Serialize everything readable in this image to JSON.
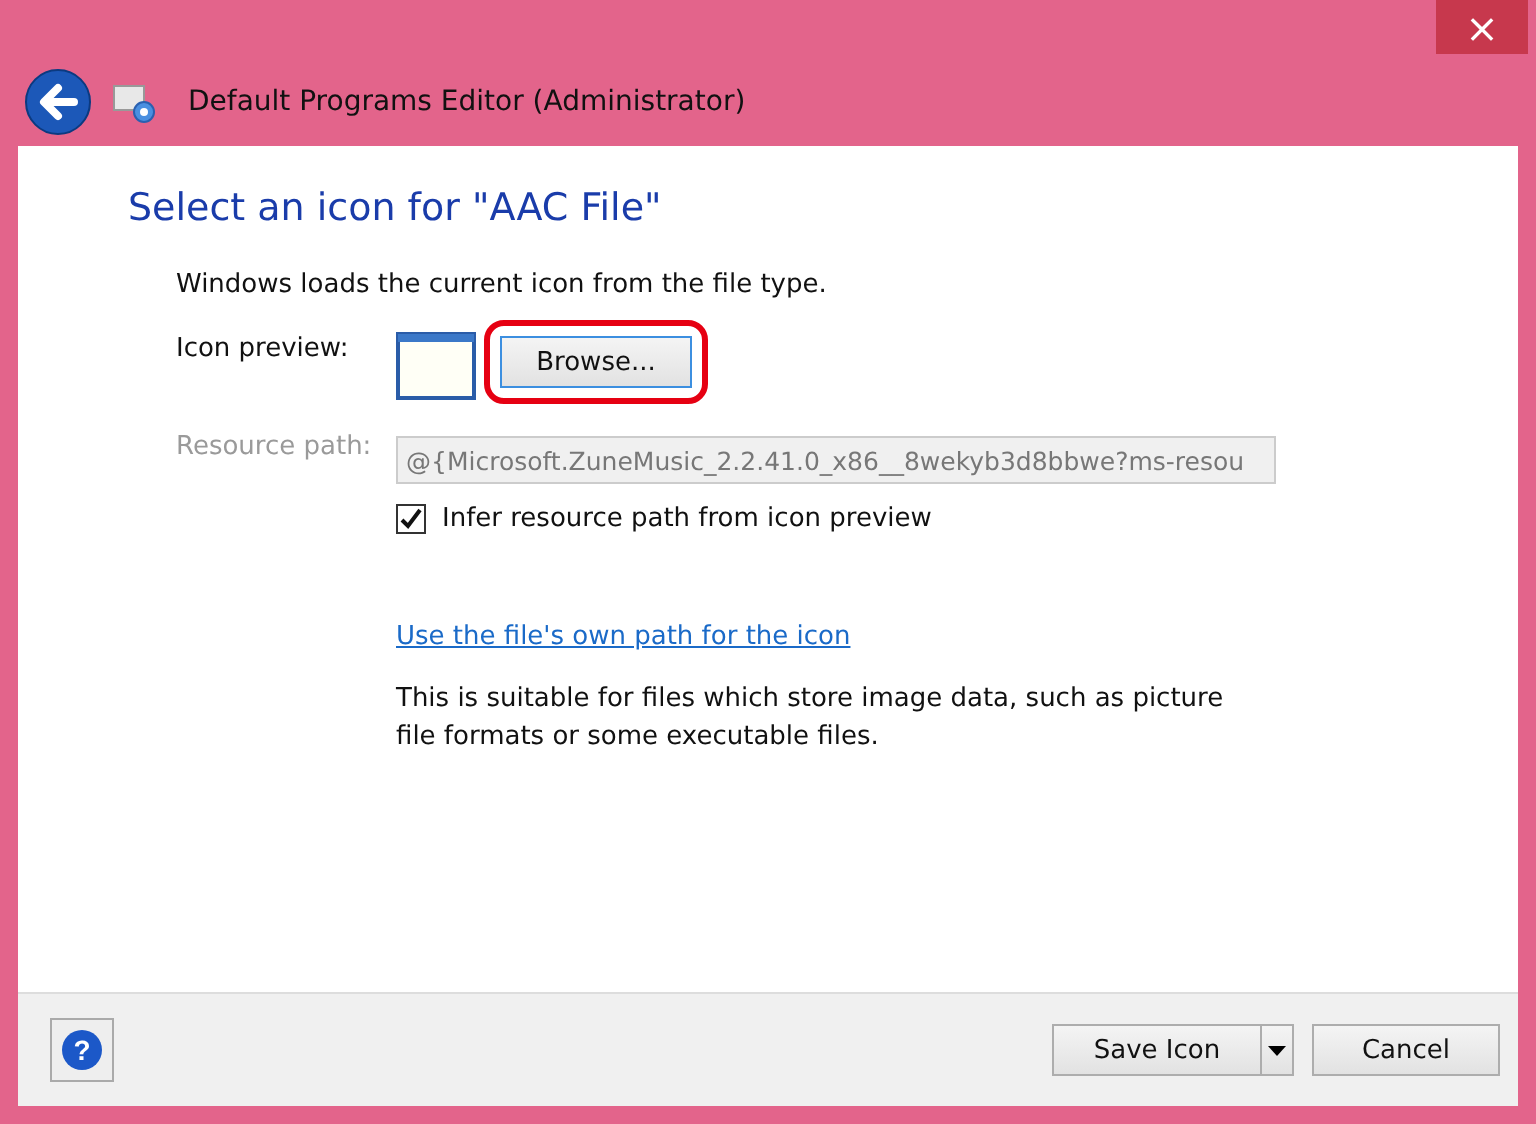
{
  "window": {
    "title": "Default Programs Editor (Administrator)",
    "close": "×"
  },
  "heading": "Select an icon for \"AAC File\"",
  "intro": "Windows loads the current icon from the file type.",
  "icon_preview": {
    "label": "Icon preview:",
    "browse_button": "Browse...",
    "highlighted": true
  },
  "resource_path": {
    "label": "Resource path:",
    "value": "@{Microsoft.ZuneMusic_2.2.41.0_x86__8wekyb3d8bbwe?ms-resou",
    "disabled": true
  },
  "infer_checkbox": {
    "label": "Infer resource path from icon preview",
    "checked": true
  },
  "link": "Use the file's own path for the icon",
  "note": "This is suitable for files which store image data, such as picture file formats or some executable files.",
  "footer": {
    "help": "?",
    "save_button": "Save Icon",
    "cancel_button": "Cancel"
  }
}
